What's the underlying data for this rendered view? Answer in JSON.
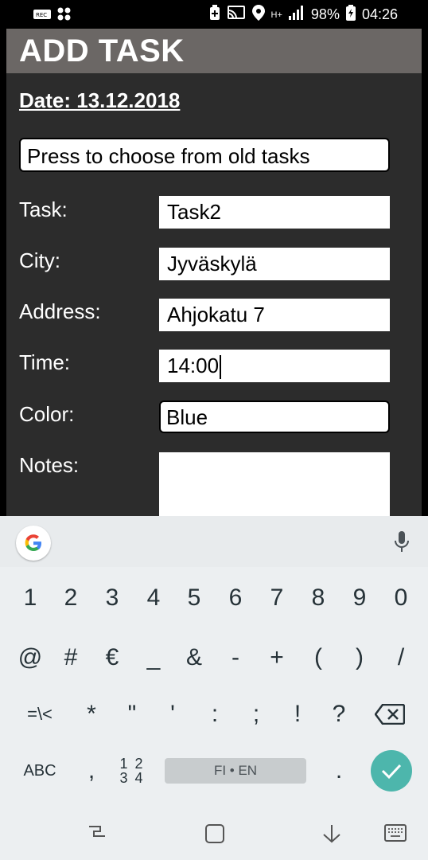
{
  "status_bar": {
    "battery": "98%",
    "time": "04:26",
    "network": "H+",
    "icons": [
      "rec-icon",
      "grid-icon",
      "battery-saver-icon",
      "cast-icon",
      "location-icon",
      "signal-icon",
      "battery-icon"
    ]
  },
  "app": {
    "title": "ADD TASK",
    "date": "Date: 13.12.2018",
    "old_tasks_button": "Press to choose from old tasks",
    "fields": {
      "task": {
        "label": "Task:",
        "value": "Task2"
      },
      "city": {
        "label": "City:",
        "value": "Jyväskylä"
      },
      "address": {
        "label": "Address:",
        "value": "Ahjokatu 7"
      },
      "time": {
        "label": "Time:",
        "value": "14:00"
      },
      "color": {
        "label": "Color:",
        "value": "Blue"
      },
      "notes": {
        "label": "Notes:",
        "value": ""
      }
    },
    "colors": {
      "background": "#2c2c2c",
      "titlebar": "#6b6765"
    }
  },
  "keyboard": {
    "row1": [
      "1",
      "2",
      "3",
      "4",
      "5",
      "6",
      "7",
      "8",
      "9",
      "0"
    ],
    "row2": [
      "@",
      "#",
      "€",
      "_",
      "&",
      "-",
      "+",
      "(",
      ")",
      "/"
    ],
    "row3": [
      "=\\<",
      "*",
      "\"",
      "'",
      ":",
      ";",
      "!",
      "?"
    ],
    "abc_label": "ABC",
    "comma": ",",
    "numpad_top": "1 2",
    "numpad_bottom": "3 4",
    "space_label": "FI • EN",
    "period": ".",
    "enter_color": "#4db6ac"
  }
}
